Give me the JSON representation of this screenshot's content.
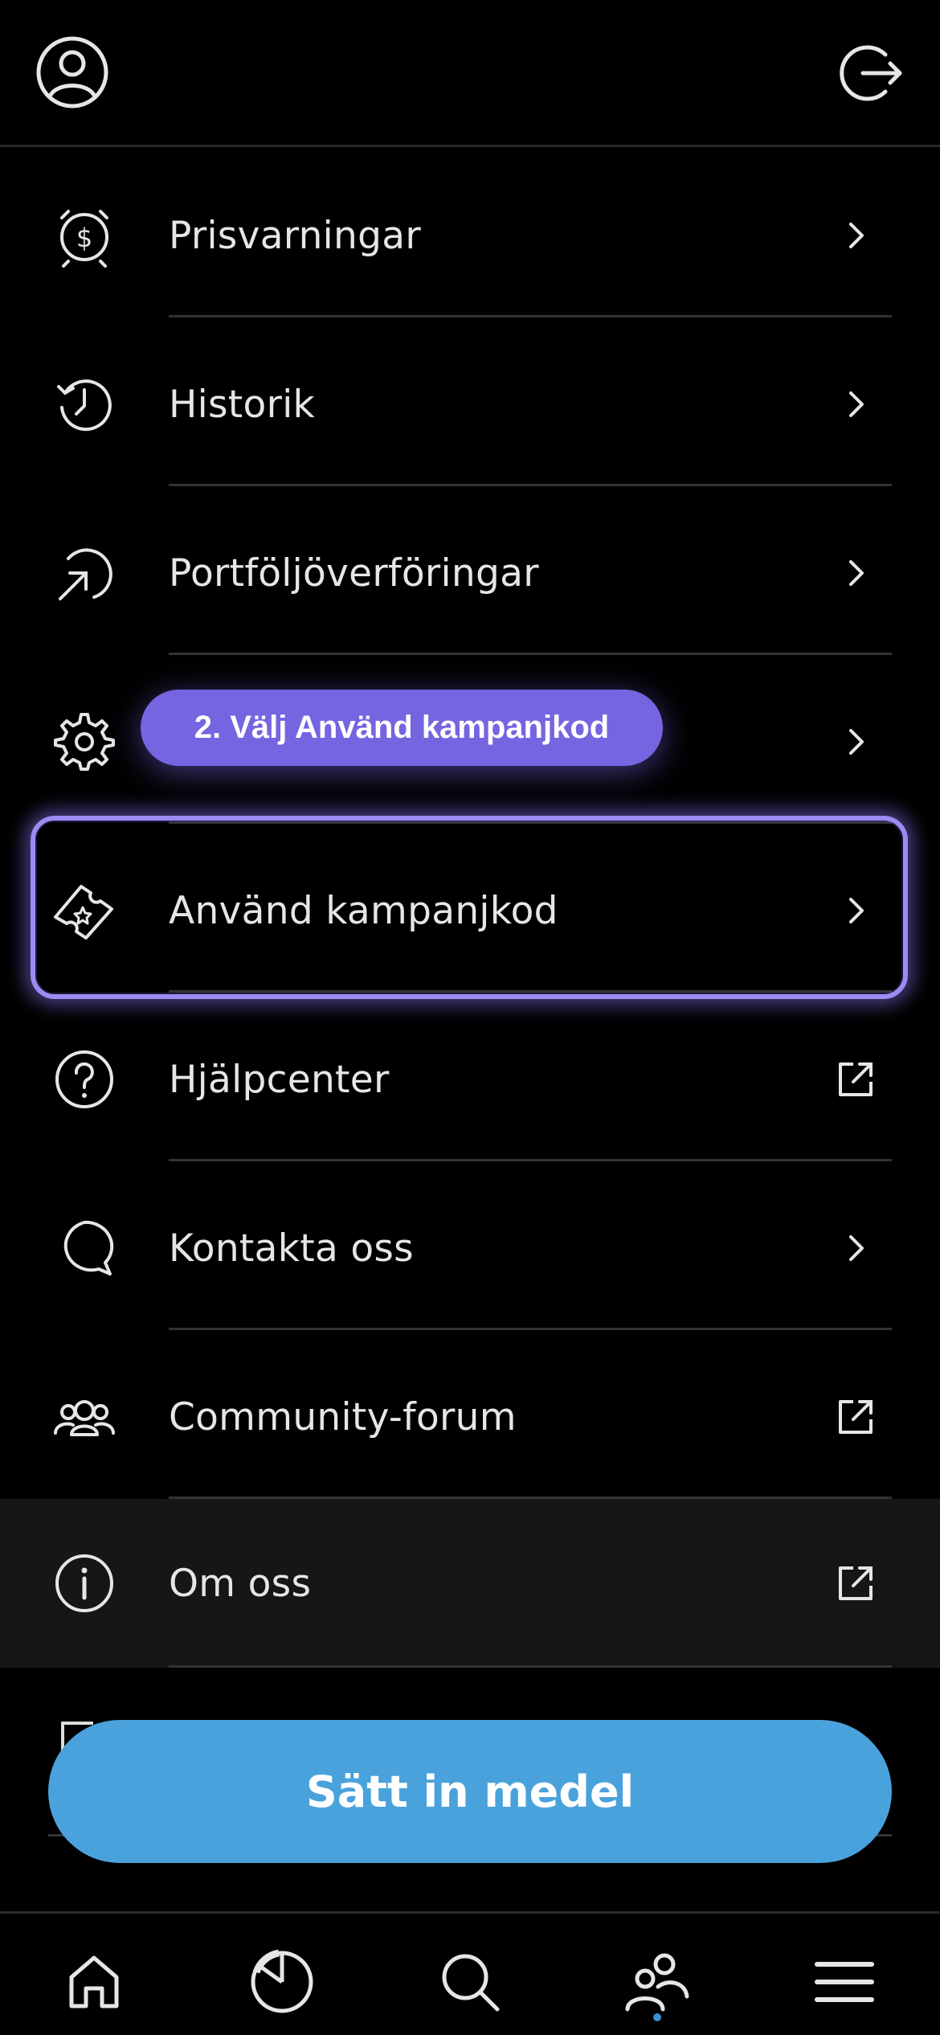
{
  "header": {
    "profile_icon": "user-circle-icon",
    "logout_icon": "logout-icon"
  },
  "menu": {
    "items": [
      {
        "label": "Prisvarningar",
        "icon": "price-alert-icon",
        "right_icon": "chevron-right-icon"
      },
      {
        "label": "Historik",
        "icon": "history-icon",
        "right_icon": "chevron-right-icon"
      },
      {
        "label": "Portföljöverföringar",
        "icon": "portfolio-transfer-icon",
        "right_icon": "chevron-right-icon"
      },
      {
        "label": "",
        "icon": "gear-icon",
        "right_icon": "chevron-right-icon"
      },
      {
        "label": "Använd kampanjkod",
        "icon": "ticket-icon",
        "right_icon": "chevron-right-icon"
      },
      {
        "label": "Hjälpcenter",
        "icon": "help-icon",
        "right_icon": "external-link-icon"
      },
      {
        "label": "Kontakta oss",
        "icon": "chat-icon",
        "right_icon": "chevron-right-icon"
      },
      {
        "label": "Community-forum",
        "icon": "community-icon",
        "right_icon": "external-link-icon"
      },
      {
        "label": "Om oss",
        "icon": "info-icon",
        "right_icon": "external-link-icon"
      }
    ]
  },
  "tooltip": {
    "text": "2. Välj Använd kampanjkod"
  },
  "deposit_button": {
    "label": "Sätt in medel"
  },
  "bottom_nav": {
    "items": [
      "home-icon",
      "portfolio-chart-icon",
      "search-icon",
      "community-icon",
      "menu-icon"
    ],
    "active": "community-icon"
  },
  "colors": {
    "background": "#000000",
    "accent_purple": "#7565e0",
    "highlight_border": "#9a8cf2",
    "button_blue": "#4aa2dc",
    "active_dot": "#3b8fd0"
  }
}
